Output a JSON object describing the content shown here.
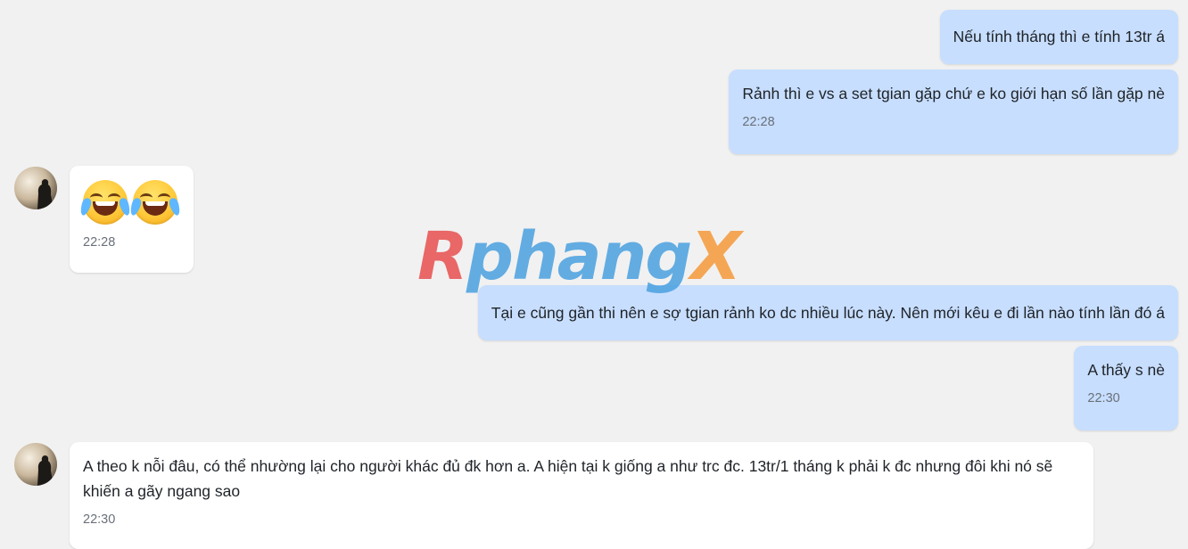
{
  "messages": [
    {
      "text": "Nếu tính tháng thì e tính 13tr á"
    },
    {
      "text": "Rảnh thì e vs a set tgian gặp chứ e ko giới hạn số lần gặp nè",
      "time": "22:28"
    },
    {
      "emoji": [
        "face-with-tears-of-joy-icon",
        "face-with-tears-of-joy-icon"
      ],
      "time": "22:28"
    },
    {
      "text": "Tại e cũng gần thi nên e sợ tgian rảnh ko dc nhiều lúc này. Nên mới kêu e đi lần nào tính lần đó á"
    },
    {
      "text": "A thấy s nè",
      "time": "22:30"
    },
    {
      "text": "A theo k nỗi đâu, có thể nhường lại cho người khác đủ đk hơn a. A hiện tại k giống a như trc đc. 13tr/1 tháng k phải k đc nhưng đôi khi nó sẽ khiến a gãy ngang sao",
      "time": "22:30"
    }
  ],
  "watermark": {
    "part1": "R",
    "part2": "phang",
    "part3": "X"
  },
  "colors": {
    "mine_bubble": "#c7defe",
    "theirs_bubble": "#ffffff",
    "background": "#f1f1f1"
  }
}
